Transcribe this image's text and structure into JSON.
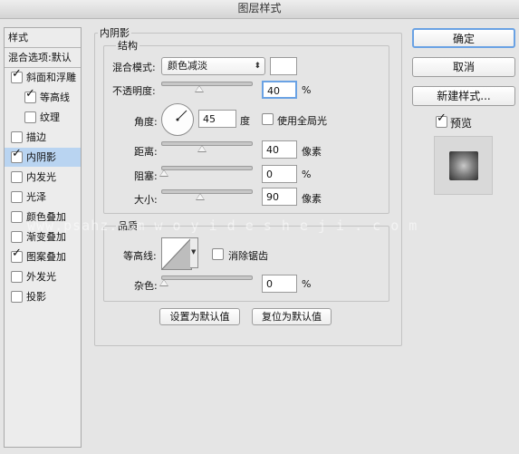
{
  "window": {
    "title": "图层样式"
  },
  "styles_panel": {
    "header": "样式",
    "blend_options": "混合选项:默认",
    "items": [
      {
        "label": "斜面和浮雕",
        "checked": true
      },
      {
        "label": "等高线",
        "checked": true
      },
      {
        "label": "纹理",
        "checked": false
      },
      {
        "label": "描边",
        "checked": false
      },
      {
        "label": "内阴影",
        "checked": true,
        "selected": true
      },
      {
        "label": "内发光",
        "checked": false
      },
      {
        "label": "光泽",
        "checked": false
      },
      {
        "label": "颜色叠加",
        "checked": false
      },
      {
        "label": "渐变叠加",
        "checked": false
      },
      {
        "label": "图案叠加",
        "checked": true
      },
      {
        "label": "外发光",
        "checked": false
      },
      {
        "label": "投影",
        "checked": false
      }
    ]
  },
  "inner_shadow": {
    "title": "内阴影",
    "structure": {
      "title": "结构",
      "blend_mode_label": "混合模式:",
      "blend_mode_value": "颜色减淡",
      "blend_color": "#ffffff",
      "opacity_label": "不透明度:",
      "opacity_value": "40",
      "opacity_unit": "%",
      "angle_label": "角度:",
      "angle_value": "45",
      "angle_unit": "度",
      "global_light_label": "使用全局光",
      "global_light_checked": false,
      "distance_label": "距离:",
      "distance_value": "40",
      "distance_unit": "像素",
      "choke_label": "阻塞:",
      "choke_value": "0",
      "choke_unit": "%",
      "size_label": "大小:",
      "size_value": "90",
      "size_unit": "像素"
    },
    "quality": {
      "title": "品质",
      "contour_label": "等高线:",
      "antialias_label": "消除锯齿",
      "antialias_checked": false,
      "noise_label": "杂色:",
      "noise_value": "0",
      "noise_unit": "%"
    },
    "set_default_label": "设置为默认值",
    "reset_default_label": "复位为默认值"
  },
  "buttons": {
    "ok": "确定",
    "cancel": "取消",
    "new_style": "新建样式...",
    "preview_label": "预览",
    "preview_checked": true
  },
  "watermark": "www.psahz.com  w o y i d e s h e j i . c o m"
}
